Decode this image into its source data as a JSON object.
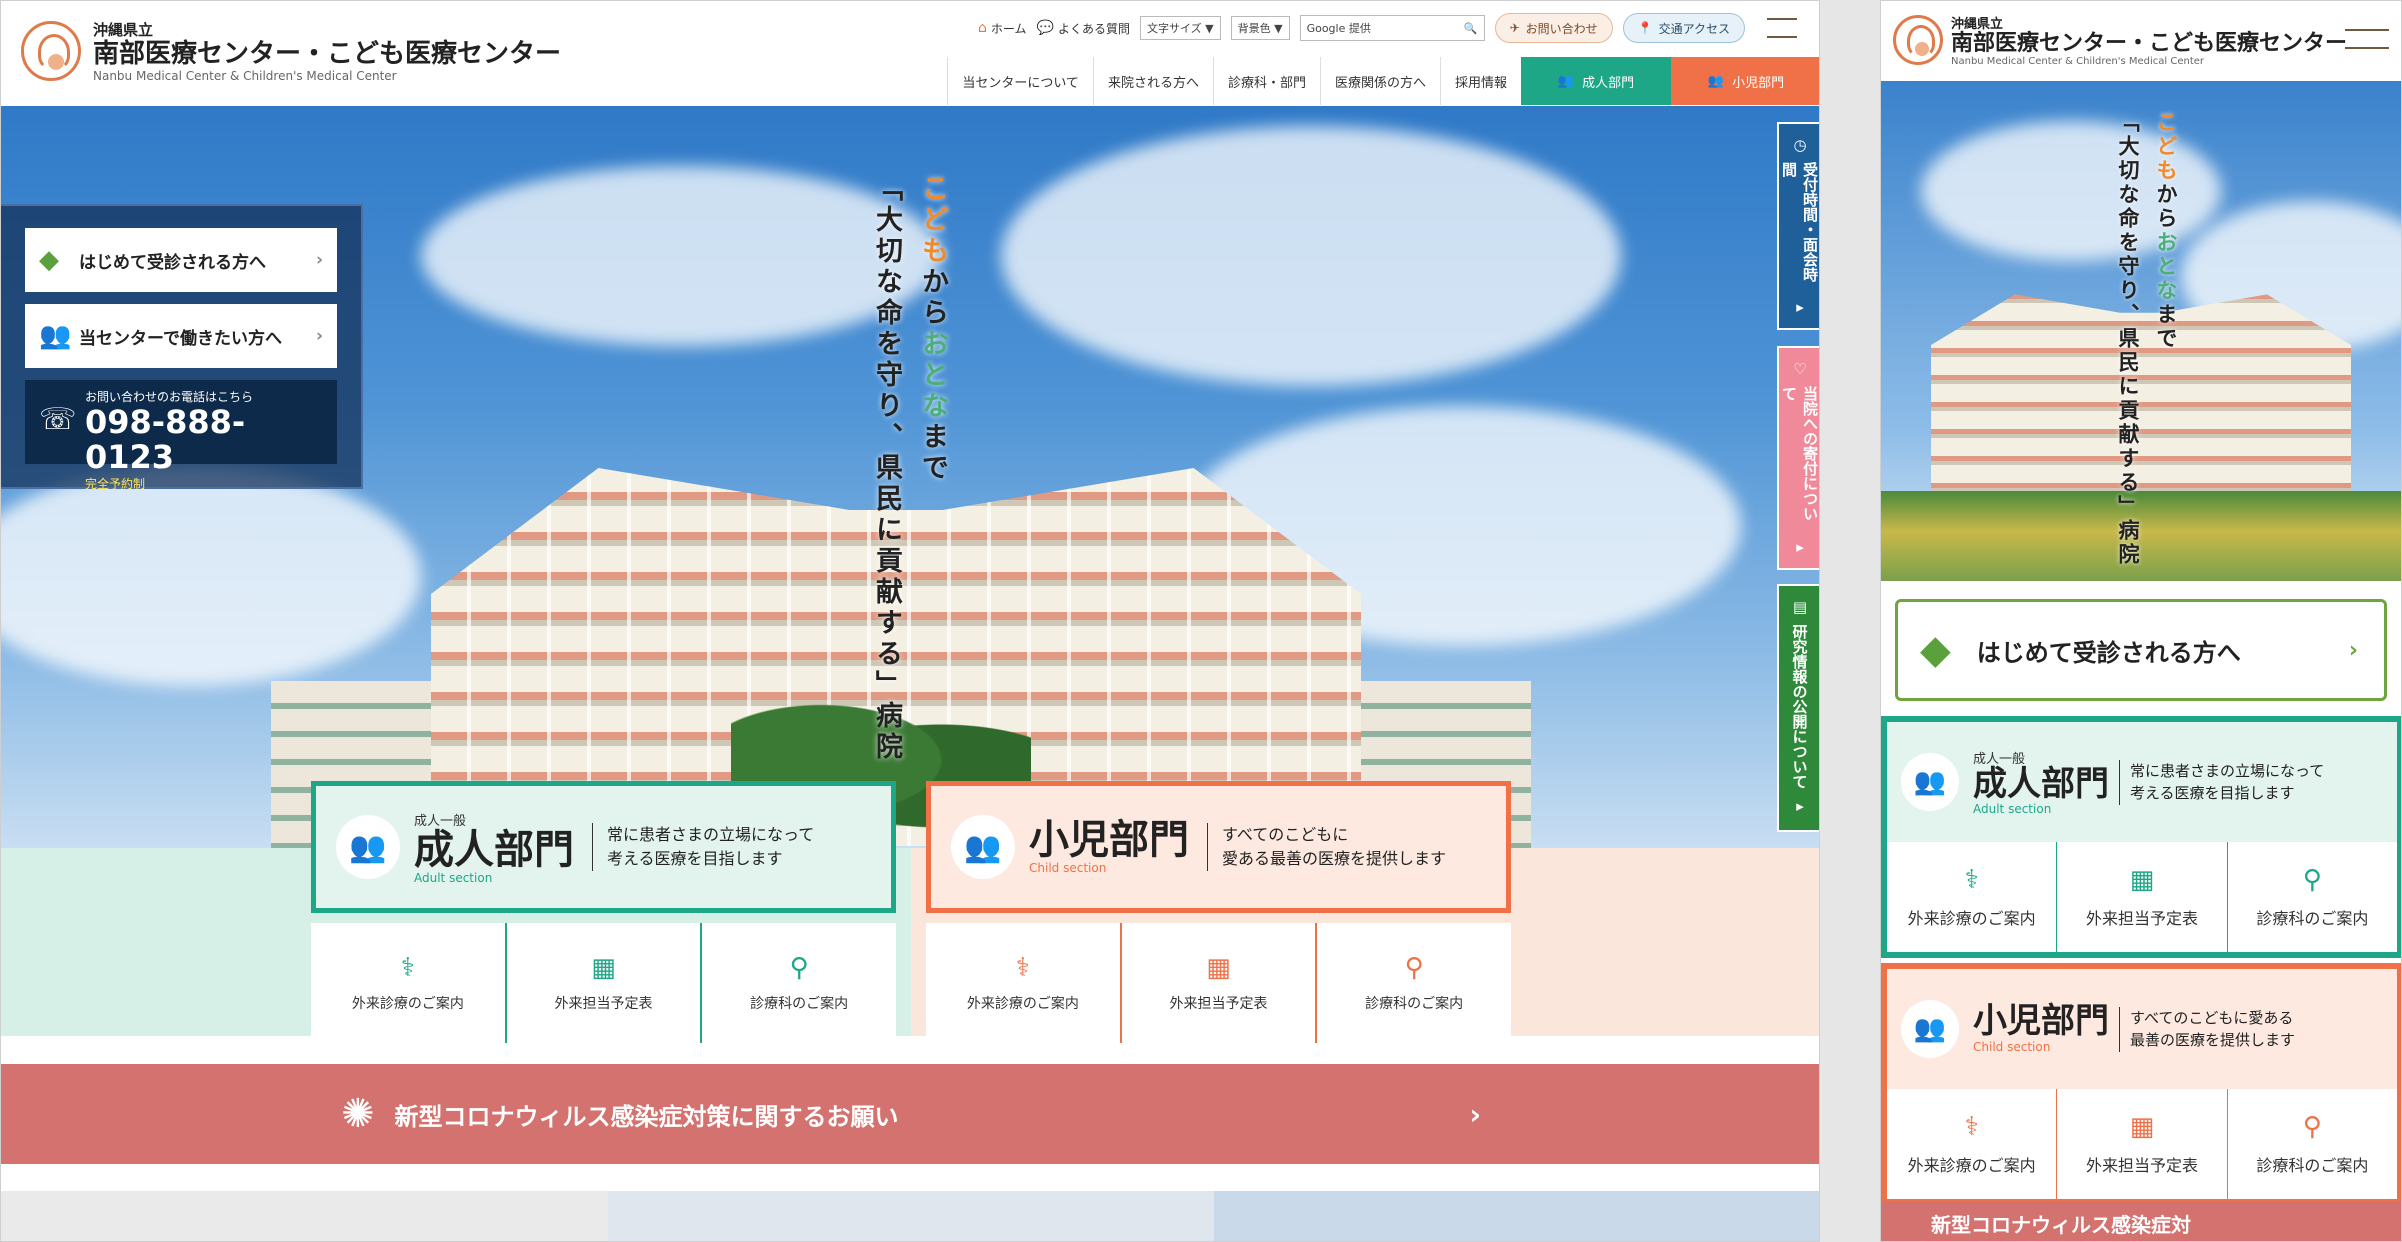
{
  "header": {
    "pref": "沖縄県立",
    "name": "南部医療センター・こども医療センター",
    "name_en": "Nanbu Medical Center & Children's Medical Center"
  },
  "util": {
    "home": "ホーム",
    "faq": "よくある質問",
    "font_size": "文字サイズ ▼",
    "bg_color": "背景色 ▼",
    "search_label": "Google 提供",
    "contact": "お問い合わせ",
    "access": "交通アクセス"
  },
  "gnav": {
    "items": [
      "当センターについて",
      "来院される方へ",
      "診療科・部門",
      "医療関係の方へ",
      "採用情報"
    ],
    "adult": "成人部門",
    "child": "小児部門"
  },
  "hero": {
    "copy_line1_parts": [
      "こども",
      "から",
      "おとな",
      "まで"
    ],
    "copy_line2": "「大切な命を守り、県民に貢献する」病院"
  },
  "quick": {
    "first_visit": "はじめて受診される方へ",
    "work": "当センターで働きたい方へ",
    "tel_label": "お問い合わせのお電話はこちら",
    "tel": "098-888-0123",
    "tel_note": "完全予約制"
  },
  "side_tabs": {
    "hours": "受付時間・面会時間",
    "donation": "当院への寄付について",
    "research": "研究情報の公開について"
  },
  "adult": {
    "sub": "成人一般",
    "title": "成人部門",
    "en": "Adult section",
    "desc_line1": "常に患者さまの立場になって",
    "desc_line2": "考える医療を目指します",
    "links": [
      "外来診療のご案内",
      "外来担当予定表",
      "診療科のご案内"
    ]
  },
  "child": {
    "title": "小児部門",
    "en": "Child section",
    "desc_line1": "すべてのこどもに",
    "desc_line2": "愛ある最善の医療を提供します",
    "links": [
      "外来診療のご案内",
      "外来担当予定表",
      "診療科のご案内"
    ]
  },
  "mobile": {
    "child_desc_line1": "すべてのこどもに愛ある",
    "child_desc_line2": "最善の医療を提供します",
    "notice_partial": "新型コロナウィルス感染症対"
  },
  "notice": {
    "text": "新型コロナウィルス感染症対策に関するお願い"
  },
  "colors": {
    "adult": "#1ea787",
    "child": "#f07148",
    "notice": "#d3726f",
    "first_visit": "#6ea53e"
  }
}
